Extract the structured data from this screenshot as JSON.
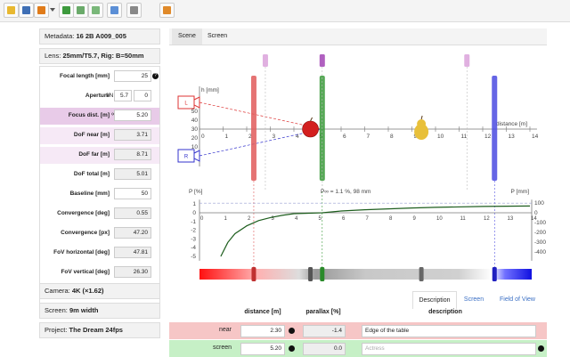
{
  "toolbar": {
    "buttons": [
      {
        "name": "open-folder-icon",
        "color": "#e8b830"
      },
      {
        "name": "save-icon",
        "color": "#3f6fb5"
      },
      {
        "name": "clock-icon",
        "color": "#e07b1a"
      },
      {
        "name": "google-icon",
        "color": "#3d9a3d"
      },
      {
        "name": "upload-icon",
        "color": "#6aaa6a"
      },
      {
        "name": "landscape-icon",
        "color": "#7ab87a"
      },
      {
        "name": "move-icon",
        "color": "#5b8fd6"
      },
      {
        "name": "camera-icon",
        "color": "#888888"
      },
      {
        "name": "grid-icon",
        "color": "#e08a2a"
      }
    ]
  },
  "left": {
    "metadata": {
      "label": "Metadata:",
      "value": "16 2B A009_005"
    },
    "lens": {
      "label": "Lens:",
      "value": "25mm/T5.7, Rig: B=50mm"
    },
    "params": [
      {
        "label": "Focal length [mm]",
        "value": "25",
        "help": "?"
      },
      {
        "label": "Aperture",
        "prefix": "f/N",
        "value": "5.7",
        "value2": "0"
      },
      {
        "label": "Focus dist. [m]",
        "prefix": "∞",
        "value": "5.20"
      },
      {
        "label": "DoF near [m]",
        "value": "3.71"
      },
      {
        "label": "DoF far [m]",
        "value": "8.71"
      },
      {
        "label": "DoF total [m]",
        "value": "5.01"
      },
      {
        "label": "Baseline [mm]",
        "value": "50"
      },
      {
        "label": "Convergence [deg]",
        "value": "0.55"
      },
      {
        "label": "Convergence [px]",
        "value": "47.20"
      },
      {
        "label": "FoV horizontal [deg]",
        "value": "47.81"
      },
      {
        "label": "FoV vertical [deg]",
        "value": "26.30"
      },
      {
        "label": "FoV diagonal [deg]",
        "value": "53.22"
      }
    ],
    "camera": {
      "label": "Camera:",
      "value": "4K (×1.62)"
    },
    "screen": {
      "label": "Screen:",
      "value": "9m width"
    },
    "project": {
      "label": "Project:",
      "value": "The Dream 24fps"
    }
  },
  "tabs": [
    {
      "label": "Scene"
    },
    {
      "label": "Screen"
    }
  ],
  "chart_data": {
    "type": "line",
    "top_axis": {
      "label": "distance [m]",
      "ticks": [
        "0",
        "1",
        "2",
        "3",
        "4",
        "5",
        "6",
        "7",
        "8",
        "9",
        "10",
        "11",
        "12",
        "13",
        "14"
      ]
    },
    "height_axis": {
      "label": "h [mm]",
      "ticks": [
        "60",
        "50",
        "40",
        "30",
        "20",
        "10",
        "0"
      ]
    },
    "cameras": [
      {
        "label": "L"
      },
      {
        "label": "R"
      }
    ],
    "markers": [
      {
        "name": "near",
        "distance": 2.3,
        "color": "#e05a5a"
      },
      {
        "name": "screen",
        "distance": 5.2,
        "color": "#3a9a3a"
      },
      {
        "name": "far",
        "distance": 12.5,
        "color": "#4a4ae0"
      }
    ],
    "objects": [
      {
        "name": "apple",
        "distance": 4.7
      },
      {
        "name": "pear",
        "distance": 9.4
      }
    ],
    "parallax_axis": {
      "left_label": "P [%]",
      "right_label": "P [mm]",
      "left_ticks": [
        "1",
        "0",
        "-1",
        "-2",
        "-3",
        "-4",
        "-5"
      ],
      "right_ticks": [
        "100",
        "0",
        "-100",
        "-200",
        "-300",
        "-400"
      ],
      "x_ticks": [
        "0",
        "1",
        "2",
        "3",
        "4",
        "5",
        "6",
        "7",
        "8",
        "9",
        "10",
        "11",
        "12",
        "13",
        "14"
      ]
    },
    "infinity_label": "P∞ = 1.1 %, 98 mm",
    "parallax_curve": {
      "x": [
        0.9,
        1.2,
        1.5,
        2.0,
        2.5,
        3.0,
        3.5,
        4.0,
        5.2,
        6.0,
        7.0,
        8.0,
        9.0,
        10.0,
        12.0,
        14.0
      ],
      "y": [
        -5.0,
        -3.4,
        -2.4,
        -1.5,
        -0.9,
        -0.55,
        -0.3,
        -0.1,
        0.0,
        0.2,
        0.35,
        0.45,
        0.55,
        0.62,
        0.72,
        0.78
      ]
    }
  },
  "desc_tabs": [
    {
      "label": "Description"
    },
    {
      "label": "Screen"
    },
    {
      "label": "Field of View"
    }
  ],
  "table": {
    "headers": [
      "distance [m]",
      "parallax [%]",
      "description"
    ],
    "rows": [
      {
        "name": "near",
        "distance": "2.30",
        "parallax": "-1.4",
        "description": "Edge of the table",
        "bg": "#f6c6c6"
      },
      {
        "name": "screen",
        "distance": "5.20",
        "parallax": "0.0",
        "placeholder": "Actress",
        "bg": "#c6f0c6"
      }
    ]
  }
}
